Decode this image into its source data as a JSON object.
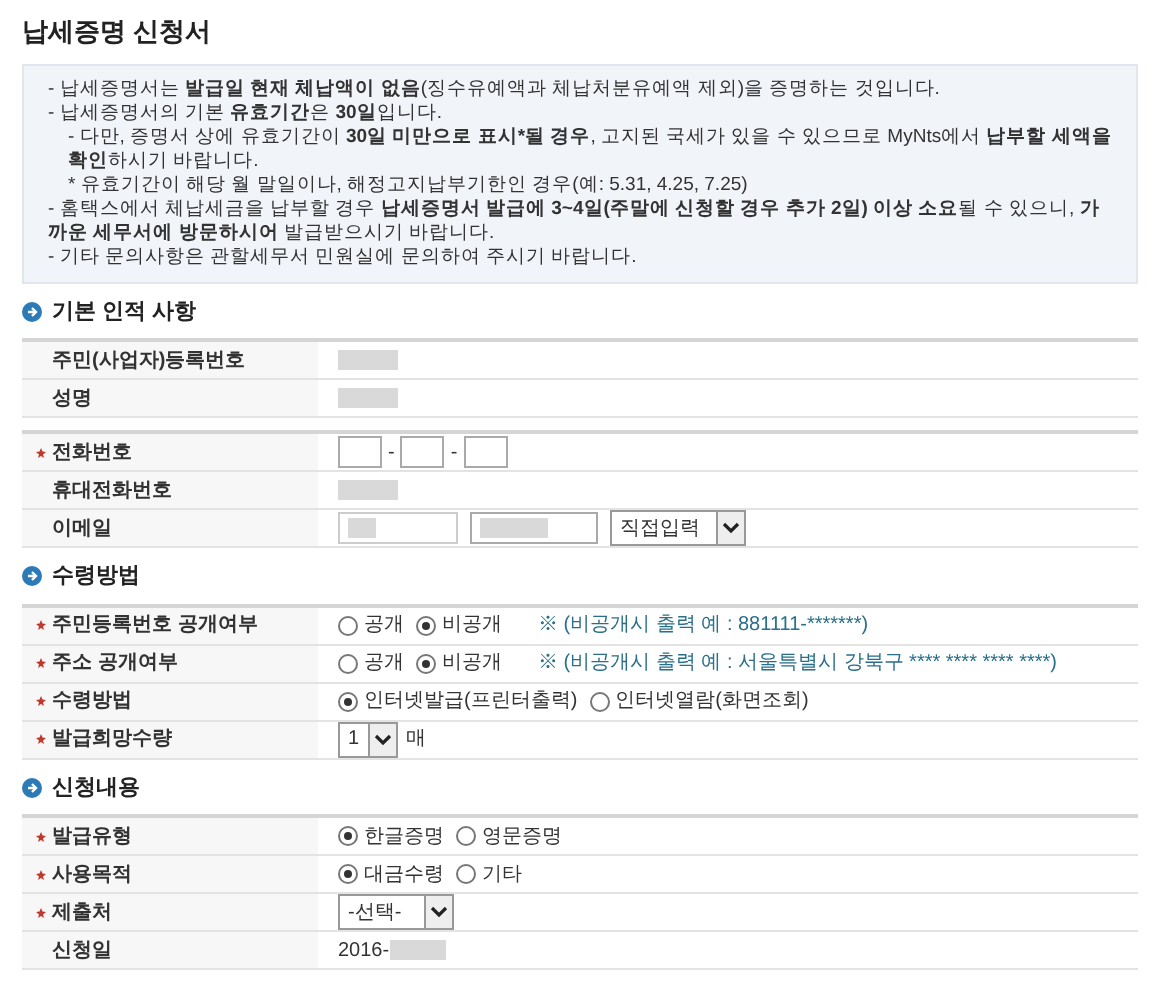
{
  "title": "납세증명 신청서",
  "notice": [
    {
      "kind": "item",
      "text": "- 납세증명서는 **발급일 현재 체납액이 없음**(징수유예액과 체납처분유예액 제외)을 증명하는 것입니다."
    },
    {
      "kind": "item",
      "text": "- 납세증명서의 기본 **유효기간**은 **30일**입니다."
    },
    {
      "kind": "sub",
      "text": "- 다만, 증명서 상에 유효기간이 **30일 미만으로 표시*될 경우**, 고지된 국세가 있을 수 있으므로 MyNts에서 **납부할 세액을 확인**하시기 바랍니다."
    },
    {
      "kind": "sub",
      "text": "* 유효기간이 해당 월 말일이나, 해정고지납부기한인 경우(예: 5.31, 4.25, 7.25)"
    },
    {
      "kind": "item",
      "text": "- 홈택스에서 체납세금을 납부할 경우 **납세증명서 발급에 3~4일(주말에 신청할 경우 추가 2일) 이상 소요**될 수 있으니, **가까운 세무서에 방문하시어** 발급받으시기 바랍니다."
    },
    {
      "kind": "item",
      "text": "- 기타 문의사항은 관할세무서 민원실에 문의하여 주시기 바랍니다."
    }
  ],
  "sections": [
    {
      "title": "기본 인적 사항",
      "groups": [
        [
          {
            "label": "주민(사업자)등록번호",
            "required": false,
            "kind": "masked"
          },
          {
            "label": "성명",
            "required": false,
            "kind": "masked"
          }
        ],
        [
          {
            "label": "전화번호",
            "required": true,
            "kind": "phone",
            "separator": "-"
          },
          {
            "label": "휴대전화번호",
            "required": false,
            "kind": "masked"
          },
          {
            "label": "이메일",
            "required": false,
            "kind": "email",
            "select": "직접입력"
          }
        ]
      ]
    },
    {
      "title": "수령방법",
      "groups": [
        [
          {
            "label": "주민등록번호 공개여부",
            "required": true,
            "kind": "radio",
            "options": [
              {
                "label": "공개",
                "selected": false
              },
              {
                "label": "비공개",
                "selected": true
              }
            ],
            "note": "※ (비공개시 출력 예 : 881111-*******)"
          },
          {
            "label": "주소 공개여부",
            "required": true,
            "kind": "radio",
            "options": [
              {
                "label": "공개",
                "selected": false
              },
              {
                "label": "비공개",
                "selected": true
              }
            ],
            "note": "※ (비공개시 출력 예 : 서울특별시 강북구 **** **** **** ****)"
          },
          {
            "label": "수령방법",
            "required": true,
            "kind": "radio",
            "options": [
              {
                "label": "인터넷발급(프린터출력)",
                "selected": true
              },
              {
                "label": "인터넷열람(화면조회)",
                "selected": false
              }
            ]
          },
          {
            "label": "발급희망수량",
            "required": true,
            "kind": "select",
            "value": "1",
            "suffix": "매"
          }
        ]
      ]
    },
    {
      "title": "신청내용",
      "groups": [
        [
          {
            "label": "발급유형",
            "required": true,
            "kind": "radio",
            "options": [
              {
                "label": "한글증명",
                "selected": true
              },
              {
                "label": "영문증명",
                "selected": false
              }
            ]
          },
          {
            "label": "사용목적",
            "required": true,
            "kind": "radio",
            "options": [
              {
                "label": "대금수령",
                "selected": true
              },
              {
                "label": "기타",
                "selected": false
              }
            ]
          },
          {
            "label": "제출처",
            "required": true,
            "kind": "select",
            "value": "-선택-"
          },
          {
            "label": "신청일",
            "required": false,
            "kind": "date",
            "value": "2016-"
          }
        ]
      ]
    }
  ]
}
